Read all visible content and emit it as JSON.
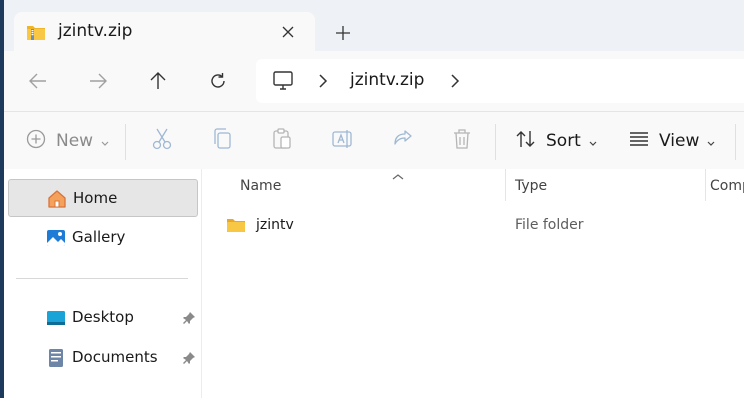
{
  "tab": {
    "title": "jzintv.zip"
  },
  "address": {
    "crumbs": [
      "jzintv.zip"
    ]
  },
  "commands": {
    "new_label": "New",
    "sort_label": "Sort",
    "view_label": "View"
  },
  "sidebar": {
    "items": [
      {
        "label": "Home",
        "icon": "home-icon",
        "selected": true
      },
      {
        "label": "Gallery",
        "icon": "gallery-icon"
      },
      {
        "label": "Desktop",
        "icon": "desktop-icon",
        "pinned": true
      },
      {
        "label": "Documents",
        "icon": "documents-icon",
        "pinned": true
      }
    ]
  },
  "filelist": {
    "columns": [
      "Name",
      "Type",
      "Comp"
    ],
    "rows": [
      {
        "name": "jzintv",
        "type": "File folder",
        "icon": "folder-icon"
      }
    ]
  },
  "colors": {
    "accent": "#0067c0",
    "folder": "#f8c845",
    "selection": "#e6e6e6"
  }
}
